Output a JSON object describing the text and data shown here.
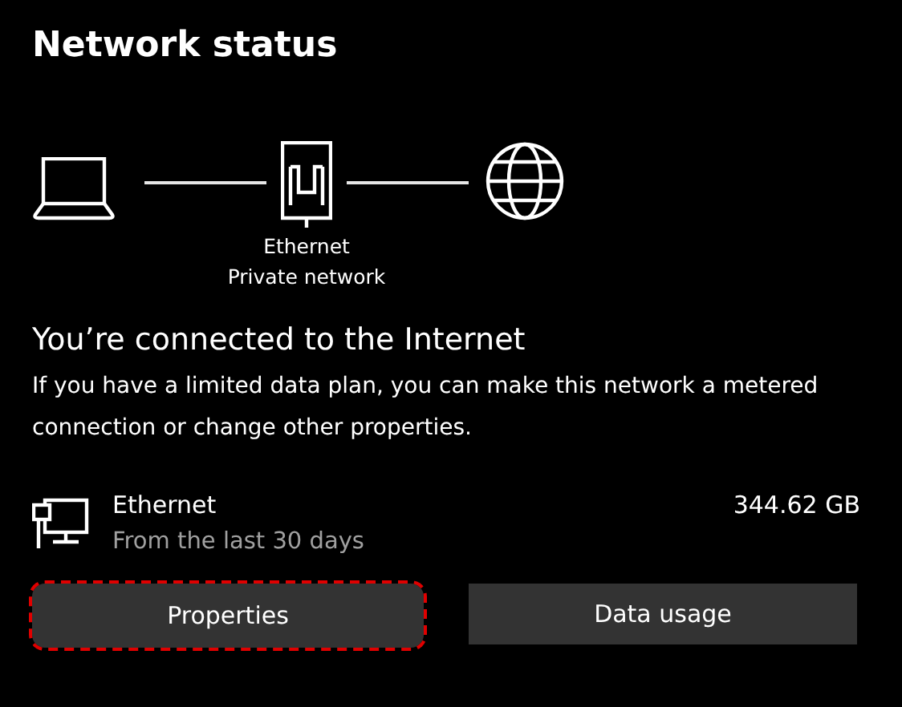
{
  "title": "Network status",
  "diagram": {
    "device_label": "Ethernet",
    "network_label": "Private network"
  },
  "status": {
    "heading": "You’re connected to the Internet",
    "description": "If you have a limited data plan, you can make this network a metered connection or change other properties."
  },
  "connection": {
    "name": "Ethernet",
    "period": "From the last 30 days",
    "usage": "344.62 GB"
  },
  "buttons": [
    {
      "label": "Properties",
      "highlighted": true
    },
    {
      "label": "Data usage",
      "highlighted": false
    }
  ]
}
